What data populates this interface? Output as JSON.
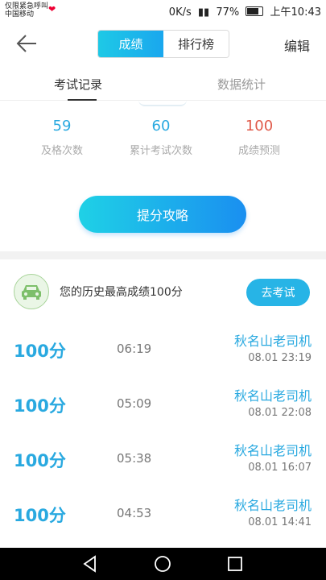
{
  "status_bar": {
    "carrier_line1": "仅限紧急呼叫",
    "carrier_line2": "中国移动",
    "net_speed": "0K/s",
    "battery_percent": "77%",
    "time": "上午10:43"
  },
  "header": {
    "back_icon": "back-arrow-icon",
    "seg_active": "成绩",
    "seg_inactive": "排行榜",
    "edit_label": "编辑"
  },
  "tabs": {
    "active": "考试记录",
    "inactive": "数据统计"
  },
  "stats": [
    {
      "value": "59",
      "label": "及格次数",
      "color": "#29a9e0"
    },
    {
      "value": "60",
      "label": "累计考试次数",
      "color": "#29a9e0"
    },
    {
      "value": "100",
      "label": "成绩预测",
      "color": "#e05a4a"
    }
  ],
  "cta_label": "提分攻略",
  "best": {
    "icon": "car-icon",
    "text": "您的历史最高成绩100分",
    "button": "去考试"
  },
  "records": [
    {
      "score": "100分",
      "duration": "06:19",
      "name": "秋名山老司机",
      "time": "08.01  23:19"
    },
    {
      "score": "100分",
      "duration": "05:09",
      "name": "秋名山老司机",
      "time": "08.01  22:08"
    },
    {
      "score": "100分",
      "duration": "05:38",
      "name": "秋名山老司机",
      "time": "08.01  16:07"
    },
    {
      "score": "100分",
      "duration": "04:53",
      "name": "秋名山老司机",
      "time": "08.01  14:41"
    }
  ],
  "colors": {
    "accent": "#29a9e0",
    "prediction": "#e05a4a"
  }
}
